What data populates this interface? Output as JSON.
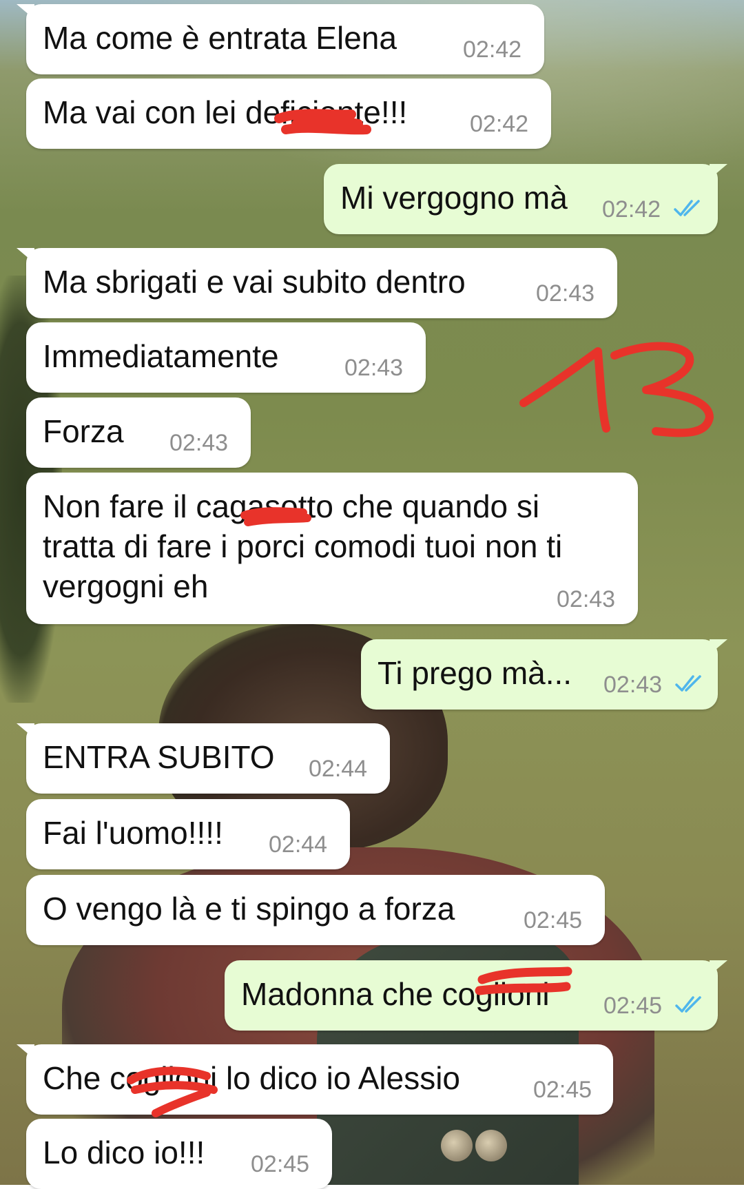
{
  "colors": {
    "incoming_bubble": "#ffffff",
    "outgoing_bubble": "#e7fcd4",
    "read_ticks": "#4fb6ec",
    "timestamp": "#8e8e8e",
    "annotation_marker": "#e8332a"
  },
  "annotation": {
    "number": "13"
  },
  "messages": [
    {
      "direction": "in",
      "text": "Ma come è entrata Elena",
      "time": "02:42"
    },
    {
      "direction": "in",
      "text": "Ma vai con lei deficiente!!!",
      "time": "02:42"
    },
    {
      "direction": "out",
      "text": "Mi vergogno mà",
      "time": "02:42",
      "status": "read"
    },
    {
      "direction": "in",
      "text": "Ma sbrigati e vai subito dentro",
      "time": "02:43"
    },
    {
      "direction": "in",
      "text": "Immediatamente",
      "time": "02:43"
    },
    {
      "direction": "in",
      "text": "Forza",
      "time": "02:43"
    },
    {
      "direction": "in",
      "lines": [
        "Non fare il cagasotto che quando si",
        "tratta di fare i porci comodi tuoi non ti",
        "vergogni eh"
      ],
      "time": "02:43"
    },
    {
      "direction": "out",
      "text": "Ti prego mà...",
      "time": "02:43",
      "status": "read"
    },
    {
      "direction": "in",
      "text": "ENTRA SUBITO",
      "time": "02:44"
    },
    {
      "direction": "in",
      "text": "Fai l'uomo!!!!",
      "time": "02:44"
    },
    {
      "direction": "in",
      "text": "O vengo là e ti spingo a forza",
      "time": "02:45"
    },
    {
      "direction": "out",
      "text": "Madonna che coglioni",
      "time": "02:45",
      "status": "read"
    },
    {
      "direction": "in",
      "text": "Che coglioni lo dico io Alessio",
      "time": "02:45"
    },
    {
      "direction": "in",
      "text": "Lo dico io!!!",
      "time": "02:45"
    }
  ]
}
